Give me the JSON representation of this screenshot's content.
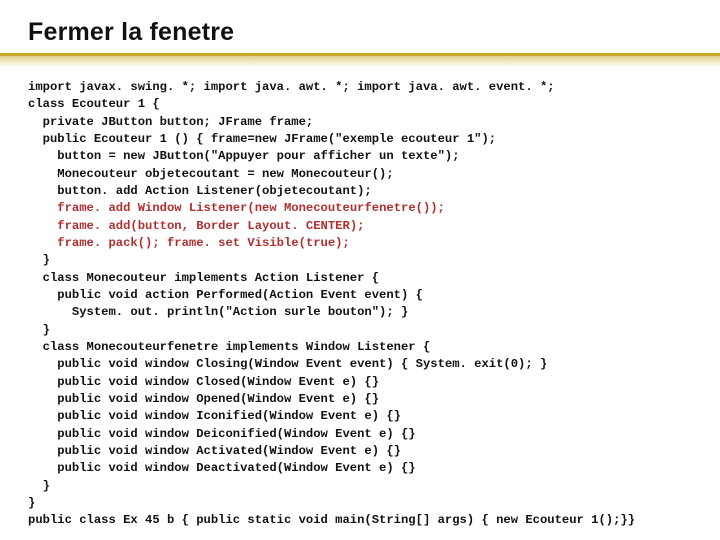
{
  "title": "Fermer la fenetre",
  "code": {
    "l1": "import javax. swing. *; import java. awt. *; import java. awt. event. *;",
    "l2": "class Ecouteur 1 {",
    "l3": "  private JButton button; JFrame frame;",
    "l4": "  public Ecouteur 1 () { frame=new JFrame(\"exemple ecouteur 1\");",
    "l5": "    button = new JButton(\"Appuyer pour afficher un texte\");",
    "l6": "    Monecouteur objetecoutant = new Monecouteur();",
    "l7": "    button. add Action Listener(objetecoutant);",
    "l8a": "    ",
    "l8b": "frame. add Window Listener(new Monecouteurfenetre());",
    "l9a": "    ",
    "l9b": "frame. add(button, Border Layout. CENTER);",
    "l10a": "    ",
    "l10b": "frame. pack(); frame. set Visible(true);",
    "l11": "  }",
    "l12": "  class Monecouteur implements Action Listener {",
    "l13": "    public void action Performed(Action Event event) {",
    "l14": "      System. out. println(\"Action surle bouton\"); }",
    "l15": "  }",
    "l16": "  class Monecouteurfenetre implements Window Listener {",
    "l17": "    public void window Closing(Window Event event) { System. exit(0); }",
    "l18": "    public void window Closed(Window Event e) {}",
    "l19": "    public void window Opened(Window Event e) {}",
    "l20": "    public void window Iconified(Window Event e) {}",
    "l21": "    public void window Deiconified(Window Event e) {}",
    "l22": "    public void window Activated(Window Event e) {}",
    "l23": "    public void window Deactivated(Window Event e) {}",
    "l24": "  }",
    "l25": "}",
    "l26": "public class Ex 45 b { public static void main(String[] args) { new Ecouteur 1();}}"
  }
}
